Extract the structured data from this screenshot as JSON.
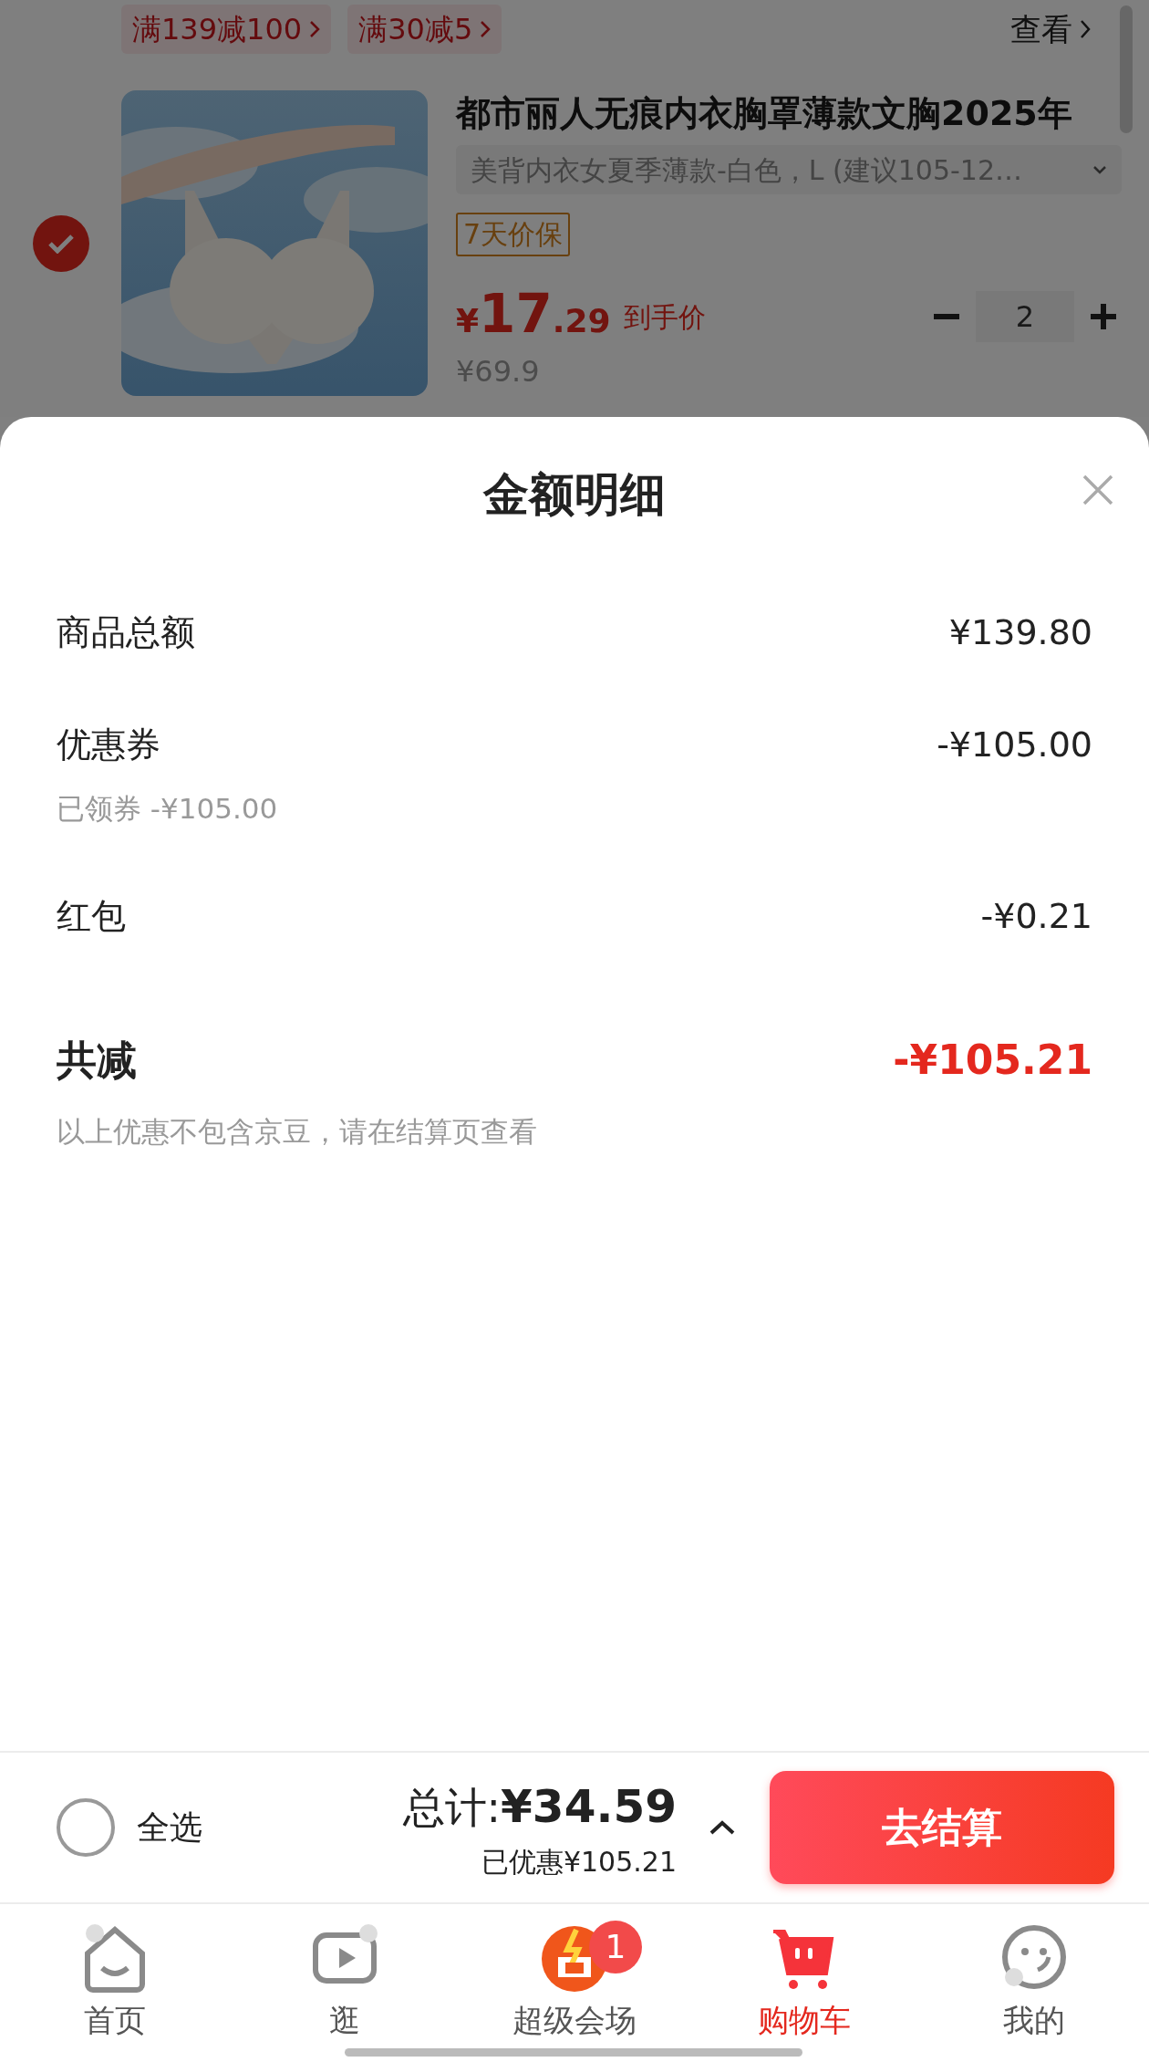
{
  "cart": {
    "promo_tags": [
      "满139减100",
      "满30减5"
    ],
    "view_link": "查看",
    "item": {
      "selected": true,
      "title": "都市丽人无痕内衣胸罩薄款文胸2025年",
      "spec": "美背内衣女夏季薄款-白色，L (建议105-12…",
      "badge": "7天价保",
      "price_currency": "¥",
      "price_integer": "17",
      "price_decimal": ".29",
      "price_label": "到手价",
      "original_price": "¥69.9",
      "quantity": "2"
    }
  },
  "sheet": {
    "title": "金额明细",
    "rows": [
      {
        "kind": "line",
        "label": "商品总额",
        "amount": "¥139.80"
      },
      {
        "kind": "line",
        "label": "优惠券",
        "amount": "-¥105.00",
        "note": "已领券 -¥105.00"
      },
      {
        "kind": "line",
        "label": "红包",
        "amount": "-¥0.21"
      },
      {
        "kind": "total",
        "label": "共减",
        "amount": "-¥105.21",
        "note": "以上优惠不包含京豆，请在结算页查看"
      }
    ]
  },
  "footer": {
    "select_all": {
      "label": "全选",
      "checked": false
    },
    "total_label": "总计:",
    "total": "¥34.59",
    "saved": "已优惠¥105.21",
    "checkout": "去结算"
  },
  "tabs": [
    {
      "label": "首页",
      "selected": false
    },
    {
      "label": "逛",
      "selected": false
    },
    {
      "label": "超级会场",
      "selected": false,
      "badge": "1"
    },
    {
      "label": "购物车",
      "selected": true
    },
    {
      "label": "我的",
      "selected": false
    }
  ]
}
